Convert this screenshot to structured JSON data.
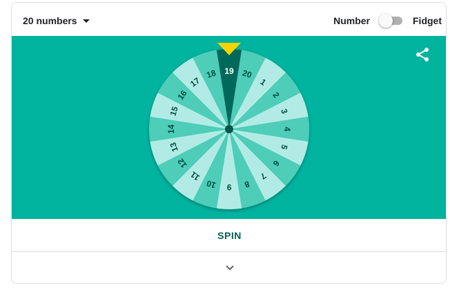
{
  "header": {
    "mode_label": "20 numbers",
    "toggle_left_label": "Number",
    "toggle_right_label": "Fidget",
    "toggle_state": "off"
  },
  "wheel": {
    "numbers": [
      "1",
      "2",
      "3",
      "4",
      "5",
      "6",
      "7",
      "8",
      "9",
      "10",
      "11",
      "12",
      "13",
      "14",
      "15",
      "16",
      "17",
      "18",
      "19",
      "20"
    ],
    "selected": "19",
    "colors": {
      "background": "#00b39e",
      "slice_light": "#b2ebe5",
      "slice_dark": "#4ecdb9",
      "selected_slice": "#00695c",
      "pointer": "#f9d300",
      "hub": "#00574b",
      "label": "#004d40",
      "selected_label": "#ffffff"
    }
  },
  "actions": {
    "spin_label": "SPIN"
  },
  "icons": {
    "caret": "caret-down-icon",
    "share": "share-icon",
    "expand": "chevron-down-icon"
  }
}
